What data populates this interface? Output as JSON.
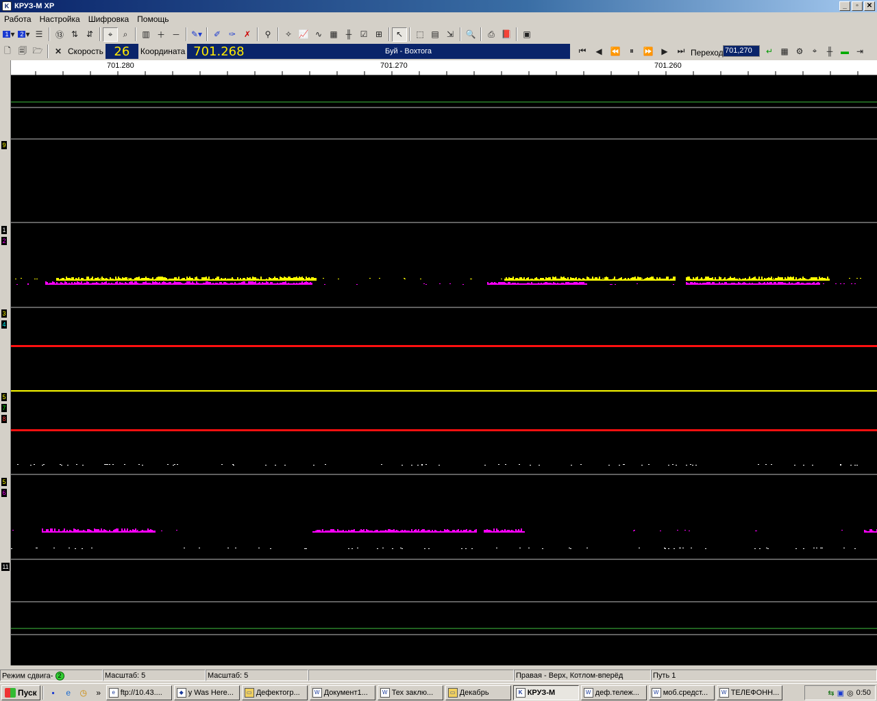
{
  "window": {
    "title": "КРУЗ-М XP",
    "buttons": [
      "_",
      "▫",
      "✕"
    ]
  },
  "menu": [
    "Работа",
    "Настройка",
    "Шифровка",
    "Помощь"
  ],
  "toolbar2": {
    "speed_label": "Скорость",
    "speed_value": "26",
    "coord_label": "Координата",
    "coord_value": "701.268",
    "route": "Буй - Вохтога",
    "goto_label": "Переход",
    "goto_value": "701,270"
  },
  "ruler": {
    "ticks": [
      "701.280",
      "701.270",
      "701.260"
    ]
  },
  "channel_markers": [
    "9",
    "1",
    "2",
    "3",
    "4",
    "5",
    "7",
    "8",
    "5",
    "6",
    "11"
  ],
  "statusbar": {
    "mode": "Режим сдвига-",
    "mode_value": "2",
    "scale1": "Масштаб: 5",
    "scale2": "Масштаб: 5",
    "empty": "",
    "side": "Правая - Верх, Котлом-вперёд",
    "track": "Путь 1"
  },
  "taskbar": {
    "start": "Пуск",
    "tasks": [
      "ftp://10.43....",
      "y Was Here...",
      "Дефектогр...",
      "Документ1...",
      "Тех заклю...",
      "Декабрь",
      "КРУЗ-М",
      "деф.тележ...",
      "моб.средст...",
      "ТЕЛЕФОНН..."
    ],
    "clock": "0:50"
  },
  "colors": {
    "trace_green": "#3fc23f",
    "trace_yellow": "#ffff00",
    "trace_magenta": "#ff00ff",
    "trace_red": "#ff1010",
    "divider": "#c0c0c0"
  }
}
